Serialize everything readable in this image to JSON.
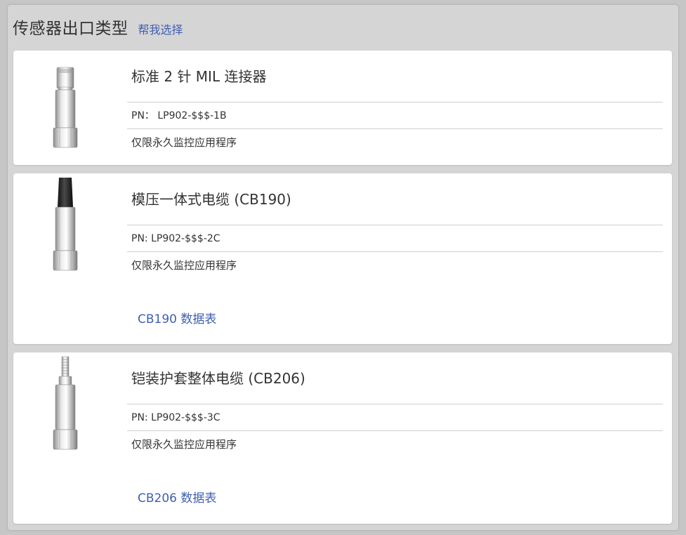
{
  "header": {
    "title": "传感器出口类型",
    "help_link": "帮我选择"
  },
  "cards": [
    {
      "title": "标准 2 针 MIL 连接器",
      "pn": "PN： LP902-$$$-1B",
      "note": "仅限永久监控应用程序",
      "image_icon": "mil-connector-sensor-icon"
    },
    {
      "title": "模压一体式电缆 (CB190)",
      "pn": "PN: LP902-$$$-2C",
      "note": "仅限永久监控应用程序",
      "datasheet": "CB190 数据表",
      "image_icon": "molded-cable-sensor-icon"
    },
    {
      "title": "铠装护套整体电缆 (CB206)",
      "pn": "PN: LP902-$$$-3C",
      "note": "仅限永久监控应用程序",
      "datasheet": "CB206 数据表",
      "image_icon": "armored-cable-sensor-icon"
    }
  ],
  "colors": {
    "link": "#3f5fb0",
    "panel": "#d5d5d5",
    "card": "#ffffff"
  }
}
